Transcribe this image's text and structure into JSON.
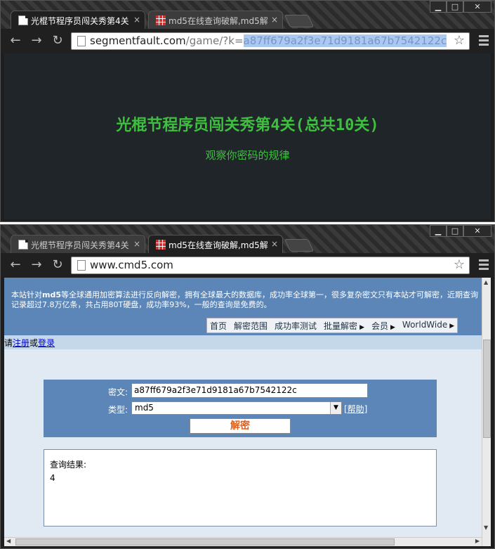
{
  "window1": {
    "tabs": [
      {
        "label": "光棍节程序员闯关秀第4关",
        "close": "×",
        "active": true
      },
      {
        "label": "md5在线查询破解,md5解",
        "close": "×",
        "active": false
      }
    ],
    "url": {
      "host": "segmentfault.com",
      "path": "/game/?k=",
      "selected": "a87ff679a2f3e71d9181a67b7542122c"
    },
    "page": {
      "title": "光棍节程序员闯关秀第4关(总共10关)",
      "subtitle": "观察你密码的规律"
    }
  },
  "window2": {
    "tabs": [
      {
        "label": "光棍节程序员闯关秀第4关",
        "close": "×",
        "active": false
      },
      {
        "label": "md5在线查询破解,md5解",
        "close": "×",
        "active": true
      }
    ],
    "url": {
      "host": "www.cmd5.com"
    },
    "page": {
      "intro_pre": "本站针对",
      "intro_bold": "md5",
      "intro_post": "等全球通用加密算法进行反向解密，拥有全球最大的数据库，成功率全球第一，很多复杂密文只有本站才可解密，近期查询记录超过7.8万亿条，共占用80T硬盘，成功率93%，一般的查询是免费的。",
      "nav": [
        {
          "label": "首页",
          "arrow": false
        },
        {
          "label": "解密范围",
          "arrow": false
        },
        {
          "label": "成功率测试",
          "arrow": false
        },
        {
          "label": "批量解密",
          "arrow": true
        },
        {
          "label": "会员",
          "arrow": true
        },
        {
          "label": "WorldWide",
          "arrow": true
        }
      ],
      "login": {
        "pre": "请",
        "register": "注册",
        "or": "或",
        "login": "登录"
      },
      "form": {
        "cipher_label": "密文:",
        "cipher_value": "a87ff679a2f3e71d9181a67b7542122c",
        "type_label": "类型:",
        "type_value": "md5",
        "help": "[帮助]",
        "submit": "解密"
      },
      "result": {
        "label": "查询结果:",
        "value": "4"
      }
    }
  },
  "window_controls": {
    "minimize": "▁",
    "maximize": "□",
    "close": "✕"
  }
}
